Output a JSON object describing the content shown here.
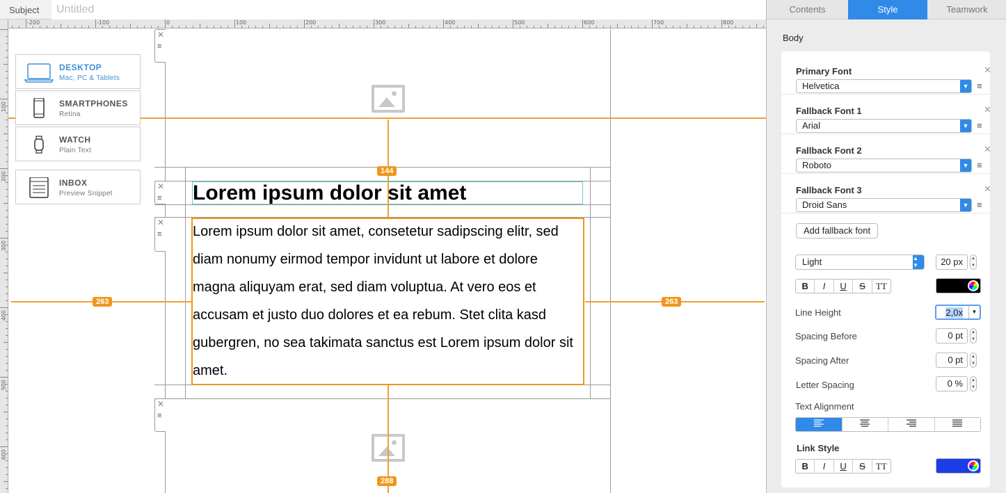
{
  "subject": {
    "label": "Subject",
    "placeholder": "Untitled"
  },
  "rulers": {
    "top": [
      "-200",
      "-100",
      "0",
      "100",
      "200",
      "300",
      "400",
      "500",
      "600",
      "700",
      "800"
    ],
    "left": [
      "100",
      "200",
      "300",
      "400",
      "500",
      "600"
    ]
  },
  "devices": [
    {
      "name": "DESKTOP",
      "sub": "Mac, PC & Tablets",
      "icon": "laptop-icon",
      "active": true
    },
    {
      "name": "SMARTPHONES",
      "sub": "Retina",
      "icon": "smartphone-icon",
      "active": false
    },
    {
      "name": "WATCH",
      "sub": "Plain Text",
      "icon": "watch-icon",
      "active": false
    },
    {
      "name": "INBOX",
      "sub": "Preview Snippet",
      "icon": "inbox-icon",
      "active": false
    }
  ],
  "content": {
    "headline": "Lorem ipsum dolor sit amet",
    "body": "Lorem ipsum dolor sit amet, consetetur sadipscing elitr, sed diam nonumy eirmod tempor invidunt ut labore et dolore magna aliquyam erat, sed diam voluptua. At vero eos et accusam et justo duo dolores et ea rebum. Stet clita kasd gubergren, no sea takimata sanctus est Lorem ipsum dolor sit amet."
  },
  "measurements": {
    "top": "144",
    "left": "263",
    "right": "263",
    "bottom": "288"
  },
  "tabs": [
    {
      "label": "Contents",
      "active": false
    },
    {
      "label": "Style",
      "active": true
    },
    {
      "label": "Teamwork",
      "active": false
    }
  ],
  "style_panel": {
    "section": "Body",
    "fonts": [
      {
        "label": "Primary Font",
        "value": "Helvetica"
      },
      {
        "label": "Fallback Font 1",
        "value": "Arial"
      },
      {
        "label": "Fallback Font 2",
        "value": "Roboto"
      },
      {
        "label": "Fallback Font 3",
        "value": "Droid Sans"
      }
    ],
    "add_fallback": "Add fallback font",
    "weight": "Light",
    "size": "20 px",
    "format_buttons": [
      "B",
      "I",
      "U",
      "S",
      "TT"
    ],
    "text_color": "#000000",
    "line_height_label": "Line Height",
    "line_height": "2,0x",
    "spacing_before_label": "Spacing Before",
    "spacing_before": "0 pt",
    "spacing_after_label": "Spacing After",
    "spacing_after": "0 pt",
    "letter_spacing_label": "Letter Spacing",
    "letter_spacing": "0 %",
    "alignment_label": "Text Alignment",
    "alignment_selected": "left",
    "link_style_label": "Link Style",
    "link_color": "#1a3de8"
  },
  "colors": {
    "accent": "#2f8ae8",
    "guide": "#f0961a"
  }
}
